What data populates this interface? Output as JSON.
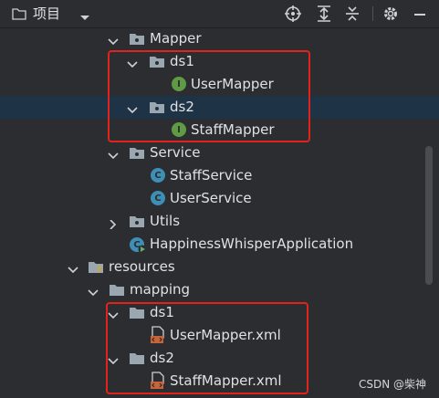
{
  "toolbar": {
    "title": "项目",
    "icons": [
      "folder-icon",
      "chevron-down-icon",
      "locate-icon",
      "expand-all-icon",
      "collapse-all-icon",
      "gear-icon",
      "minimize-icon"
    ]
  },
  "tree": {
    "rows": [
      {
        "label": "Mapper",
        "icon": "package-folder",
        "expanded": true
      },
      {
        "label": "ds1",
        "icon": "package-folder",
        "expanded": true
      },
      {
        "label": "UserMapper",
        "icon": "interface",
        "badge": "I"
      },
      {
        "label": "ds2",
        "icon": "package-folder",
        "expanded": true,
        "selected": true
      },
      {
        "label": "StaffMapper",
        "icon": "interface",
        "badge": "I"
      },
      {
        "label": "Service",
        "icon": "package-folder",
        "expanded": true
      },
      {
        "label": "StaffService",
        "icon": "class",
        "badge": "C"
      },
      {
        "label": "UserService",
        "icon": "class",
        "badge": "C"
      },
      {
        "label": "Utils",
        "icon": "package-folder",
        "expanded": false
      },
      {
        "label": "HappinessWhisperApplication",
        "icon": "spring-boot-app",
        "badge": "C"
      },
      {
        "label": "resources",
        "icon": "resources-folder",
        "expanded": true
      },
      {
        "label": "mapping",
        "icon": "folder",
        "expanded": true
      },
      {
        "label": "ds1",
        "icon": "folder",
        "expanded": true
      },
      {
        "label": "UserMapper.xml",
        "icon": "xml-file"
      },
      {
        "label": "ds2",
        "icon": "folder",
        "expanded": true
      },
      {
        "label": "StaffMapper.xml",
        "icon": "xml-file"
      }
    ]
  },
  "colors": {
    "background": "#2b2d30",
    "selection": "#1f3346",
    "highlight_box": "#e2221c",
    "interface_badge": "#5f9a44",
    "class_badge": "#3d8fb5"
  },
  "watermark": "CSDN @柴神"
}
